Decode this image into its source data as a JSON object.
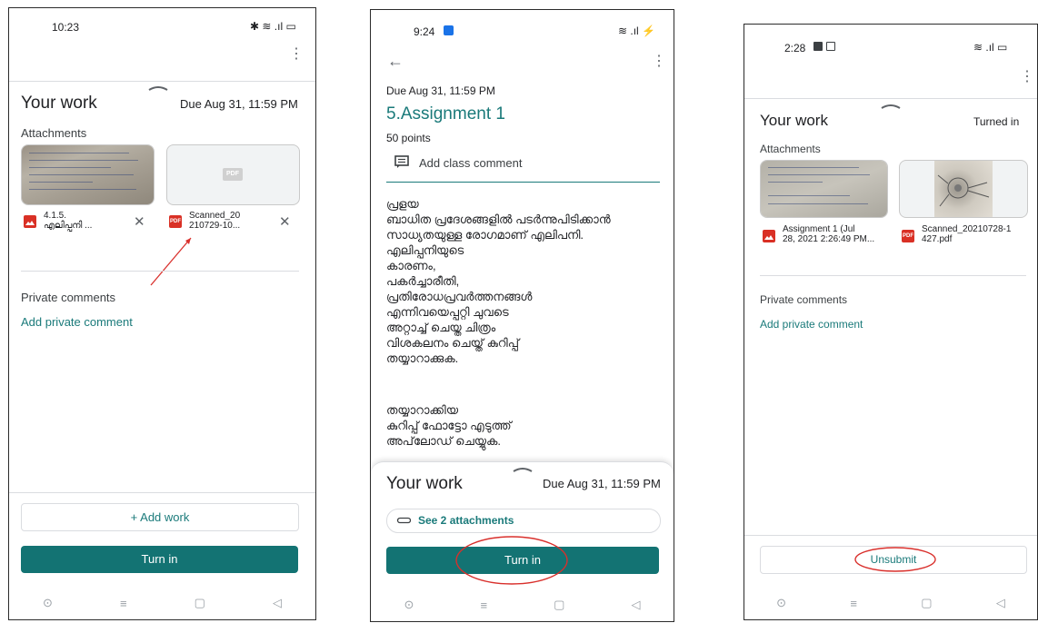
{
  "screen1": {
    "time": "10:23",
    "status_icons": "✱ ≋ .ıl ▭",
    "your_work": "Your work",
    "due": "Due Aug 31, 11:59 PM",
    "attachments_label": "Attachments",
    "attachment1_name": "4.1.5.\nഎലിപ്പനി ...",
    "attachment2_name": "Scanned_20\n210729-10...",
    "pdf_chip": "PDF",
    "pdf_badge": "PDF",
    "private_comments": "Private comments",
    "add_private_comment": "Add private comment",
    "add_work": "+ Add work",
    "turn_in": "Turn in",
    "nav": [
      "⊙",
      "≡",
      "▢",
      "◁"
    ]
  },
  "screen2": {
    "time": "9:24",
    "status_icons": "≋ .ıl ⚡",
    "back": "←",
    "due": "Due Aug 31, 11:59 PM",
    "title": "5.Assignment 1",
    "points": "50 points",
    "add_class_comment": "Add class comment",
    "body1": "പ്രളയ\nബാധിത പ്രദേശങ്ങളിൽ പടർന്നുപിടിക്കാൻ\nസാധ്യതയുള്ള രോഗമാണ് എലിപനി.\nഎലിപ്പനിയുടെ\nകാരണം,\nപകർച്ചാരീതി,\nപ്രതിരോധപ്രവർത്തനങ്ങൾ\nഎന്നിവയെപ്പറ്റി ചുവടെ\nഅറ്റാച്ച് ചെയ്ത ചിത്രം\nവിശകലനം ചെയ്ത് കുറിപ്പ്\nതയ്യാറാക്കുക.",
    "body2": "തയ്യാറാക്കിയ\nകുറിപ്പ് ഫോട്ടോ എടുത്ത്\nഅപ്‌ലോഡ് ചെയ്യുക.",
    "your_work": "Your work",
    "due2": "Due Aug 31, 11:59 PM",
    "see_attachments": "See 2 attachments",
    "turn_in": "Turn in",
    "nav": [
      "⊙",
      "≡",
      "▢",
      "◁"
    ]
  },
  "screen3": {
    "time": "2:28",
    "status_icons": "≋ .ıl ▭",
    "your_work": "Your work",
    "turned_in": "Turned in",
    "attachments_label": "Attachments",
    "attachment1_name": "Assignment 1 (Jul\n28, 2021 2:26:49 PM...",
    "attachment2_name": "Scanned_20210728-1\n427.pdf",
    "pdf_badge": "PDF",
    "private_comments": "Private comments",
    "add_private_comment": "Add private comment",
    "unsubmit": "Unsubmit",
    "nav": [
      "⊙",
      "≡",
      "▢",
      "◁"
    ]
  },
  "colors": {
    "teal": "#137373",
    "annotation_red": "#d9302c",
    "image_icon_red": "#d93025"
  }
}
